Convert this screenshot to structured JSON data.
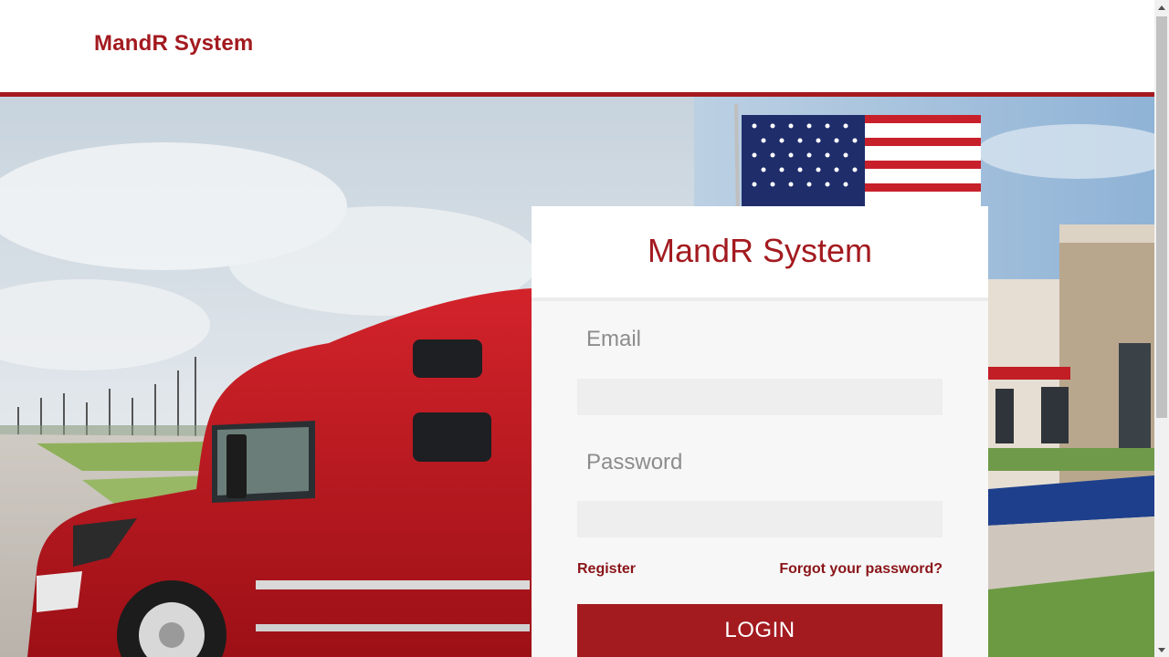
{
  "header": {
    "brand": "MandR System"
  },
  "login": {
    "title": "MandR System",
    "email_label": "Email",
    "email_value": "",
    "password_label": "Password",
    "password_value": "",
    "register_link": "Register",
    "forgot_link": "Forgot your password?",
    "login_button": "LOGIN"
  },
  "theme": {
    "accent": "#a31a1f",
    "link": "#8a1418",
    "card_bg": "#f7f7f7",
    "input_bg": "#eeeeee"
  },
  "icons": {
    "scroll_up": "chevron-up-icon",
    "scroll_down": "chevron-down-icon"
  }
}
